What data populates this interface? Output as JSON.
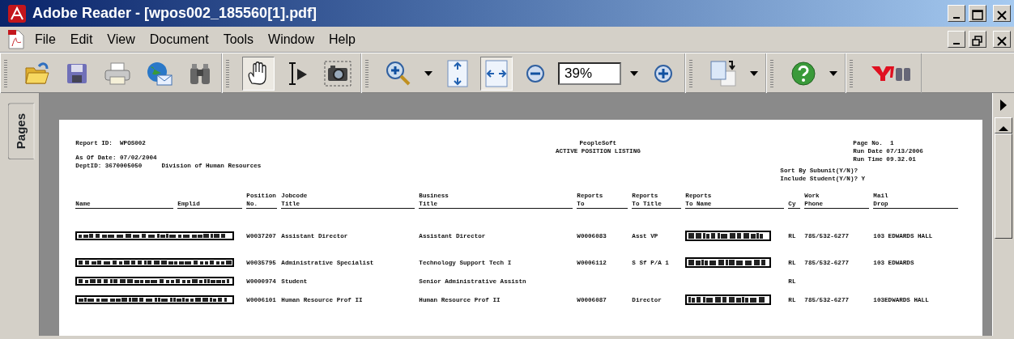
{
  "window": {
    "title": "Adobe Reader - [wpos002_185560[1].pdf]"
  },
  "menu": [
    "File",
    "Edit",
    "View",
    "Document",
    "Tools",
    "Window",
    "Help"
  ],
  "toolbar": [
    {
      "tools": [
        {
          "kind": "open",
          "selected": false
        },
        {
          "kind": "save",
          "selected": false
        },
        {
          "kind": "print",
          "selected": false
        },
        {
          "kind": "email",
          "selected": false
        },
        {
          "kind": "find",
          "selected": false
        }
      ]
    },
    {
      "tools": [
        {
          "kind": "hand",
          "selected": true
        },
        {
          "kind": "select-text",
          "selected": false
        },
        {
          "kind": "snapshot",
          "selected": false
        }
      ]
    },
    {
      "tools": [
        {
          "kind": "zoom-in-tool",
          "selected": false
        },
        {
          "kind": "caret",
          "selected": false
        },
        {
          "kind": "fit-page",
          "selected": false
        },
        {
          "kind": "fit-width",
          "selected": true
        },
        {
          "kind": "zoom-out",
          "selected": false
        },
        {
          "kind": "zoom-field",
          "value": "39%"
        },
        {
          "kind": "caret",
          "selected": false
        },
        {
          "kind": "zoom-in",
          "selected": false
        }
      ]
    },
    {
      "tools": [
        {
          "kind": "page-layout",
          "selected": false
        },
        {
          "kind": "caret",
          "selected": false
        }
      ]
    },
    {
      "tools": [
        {
          "kind": "help",
          "selected": false
        },
        {
          "kind": "caret",
          "selected": false
        }
      ]
    },
    {
      "tools": [
        {
          "kind": "yahoo",
          "selected": false
        }
      ]
    }
  ],
  "side_panel": {
    "tab": "Pages"
  },
  "report": {
    "left_header": [
      "Report ID:  WPOS002",
      "As Of Date: 07/02/2004"
    ],
    "dept": {
      "id": "DeptID: 3670005050",
      "name": "Division of Human Resources"
    },
    "title": [
      "PeopleSoft",
      "ACTIVE POSITION LISTING"
    ],
    "right_header": [
      "Page No.  1",
      "Run Date 07/13/2006",
      "Run Time 09.32.01"
    ],
    "options": [
      "Sort By Subunit(Y/N)?",
      "Include Student(Y/N)? Y"
    ],
    "columns": [
      {
        "bottom": "Name"
      },
      {
        "bottom": "Emplid"
      },
      {
        "top": "Position",
        "bottom": "No."
      },
      {
        "top": "Jobcode",
        "bottom": "Title"
      },
      {
        "top": "Business",
        "bottom": "Title"
      },
      {
        "top": "Reports",
        "bottom": "To"
      },
      {
        "top": "Reports",
        "bottom": "To Title"
      },
      {
        "top": "Reports",
        "bottom": "To Name"
      },
      {
        "bottom": "Cy"
      },
      {
        "top": "Work",
        "bottom": "Phone"
      },
      {
        "top": "Mail",
        "bottom": "Drop"
      }
    ],
    "rows": [
      {
        "position_no": "W0037207",
        "jobcode_title": "Assistant Director",
        "business_title": "Assistant Director",
        "reports_to": "W0006083",
        "reports_to_title": "Asst VP",
        "reports_to_name_redacted": true,
        "cy": "RL",
        "work_phone": "785/532-6277",
        "mail_drop": "103 EDWARDS HALL"
      },
      {
        "position_no": "W0035795",
        "jobcode_title": "Administrative Specialist",
        "business_title": "Technology Support Tech I",
        "reports_to": "W0006112",
        "reports_to_title": "S Sf P/A 1",
        "reports_to_name_redacted": true,
        "cy": "RL",
        "work_phone": "785/532-6277",
        "mail_drop": "103 EDWARDS"
      },
      {
        "position_no": "W0000974",
        "jobcode_title": "Student",
        "business_title": "Senior Administrative Assistn",
        "reports_to_name_redacted": false,
        "cy": "RL"
      },
      {
        "position_no": "W0006101",
        "jobcode_title": "Human Resource Prof II",
        "business_title": "Human Resource Prof II",
        "reports_to": "W0006087",
        "reports_to_title": "Director",
        "reports_to_name_redacted": true,
        "cy": "RL",
        "work_phone": "785/532-6277",
        "mail_drop": "103EDWARDS HALL"
      }
    ]
  }
}
